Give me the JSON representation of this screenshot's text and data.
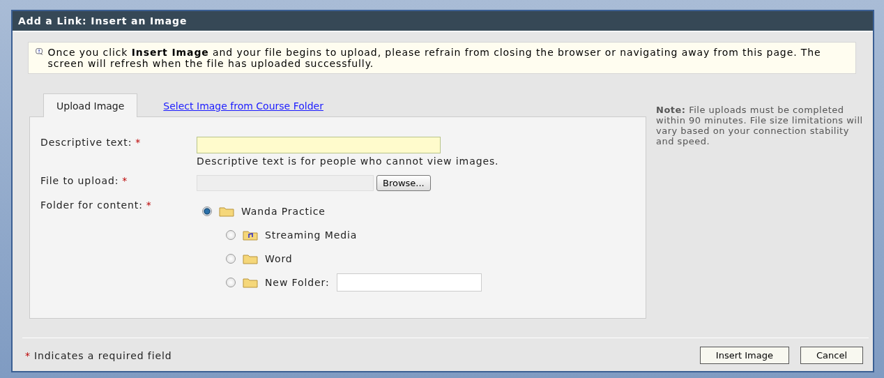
{
  "window": {
    "title": "Add a Link: Insert an Image"
  },
  "notice": {
    "text": "Once you click **Insert Image** and your file begins to upload, please refrain from closing the browser or navigating away from this page. The screen will refresh when the file has uploaded successfully."
  },
  "tabs": [
    {
      "label": "Upload Image",
      "selected": true
    },
    {
      "label": "Select Image from Course Folder",
      "selected": false
    }
  ],
  "form": {
    "descriptive_text": {
      "label": "Descriptive text:",
      "required": "*",
      "hint": "Descriptive text is for people who cannot view images."
    },
    "file": {
      "label": "File to upload:",
      "required": "*",
      "button": "Browse..."
    },
    "folder": {
      "label": "Folder for content:",
      "required": "*",
      "tree": [
        {
          "name": "Wanda Practice",
          "kind": "folder",
          "selected": true,
          "children": [
            {
              "name": "Streaming Media",
              "kind": "media",
              "selected": false
            },
            {
              "name": "Word",
              "kind": "folder",
              "selected": false
            },
            {
              "name": "New Folder:",
              "kind": "new",
              "selected": false
            }
          ]
        }
      ]
    }
  },
  "note": {
    "text": "**Note:** File uploads must be completed within 90 minutes. File size limitations will vary based on your connection stability and speed."
  },
  "footer": {
    "required_mark": "*",
    "required_text": "Indicates a required field",
    "buttons": [
      "Insert Image",
      "Cancel"
    ]
  }
}
